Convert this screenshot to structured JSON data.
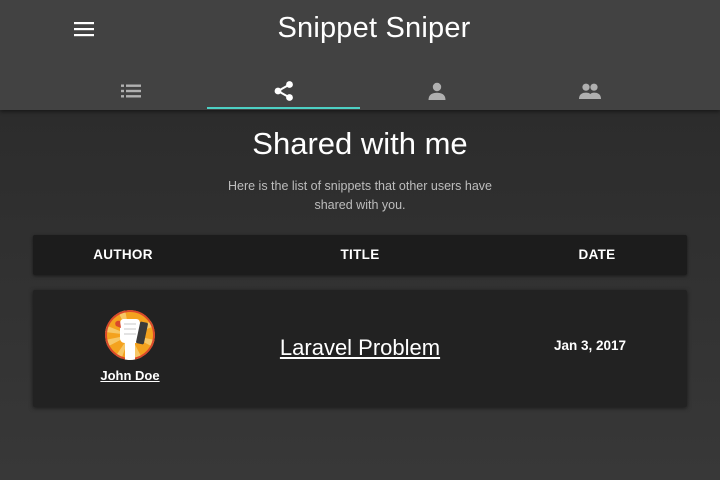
{
  "app": {
    "title": "Snippet Sniper",
    "menu_icon": "menu-icon"
  },
  "tabs": [
    {
      "icon": "list-icon",
      "selected": false
    },
    {
      "icon": "share-icon",
      "selected": true
    },
    {
      "icon": "person-icon",
      "selected": false
    },
    {
      "icon": "people-icon",
      "selected": false
    }
  ],
  "page": {
    "title": "Shared with me",
    "subtitle": "Here is the list of snippets that other users have shared with you."
  },
  "table": {
    "columns": [
      "AUTHOR",
      "TITLE",
      "DATE"
    ],
    "rows": [
      {
        "author": "John Doe",
        "avatar_icon": "raised-fist-avatar",
        "title": "Laravel Problem",
        "date": "Jan 3, 2017"
      }
    ]
  },
  "colors": {
    "appbar": "#424242",
    "accent": "#4dd0c4",
    "background": "#303030",
    "header_row": "#1c1c1c",
    "row": "#222222",
    "icon": "#b0b0b0"
  }
}
